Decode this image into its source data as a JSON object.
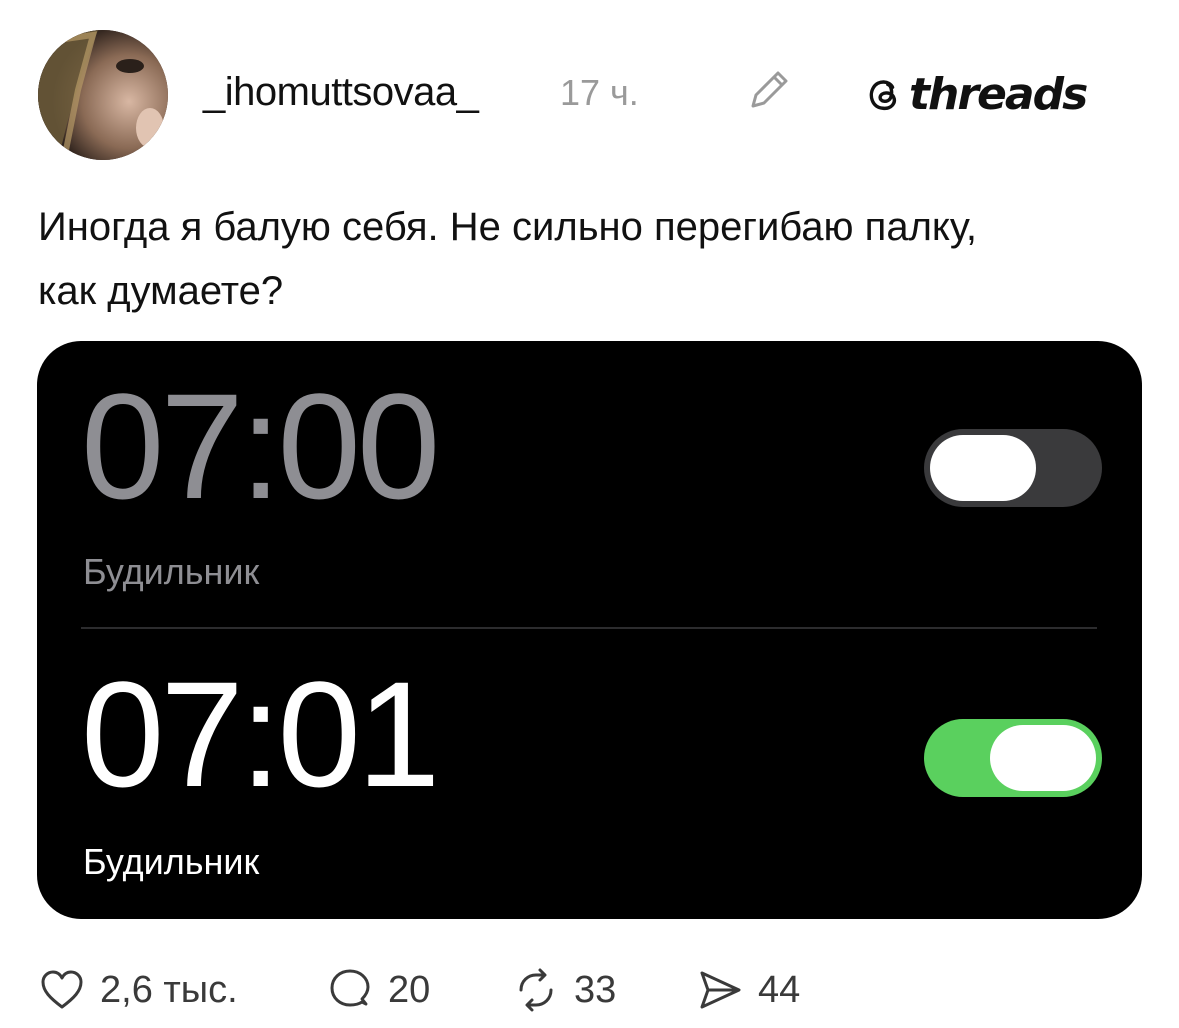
{
  "post": {
    "username": "_ihomuttsovaa_",
    "time": "17 ч.",
    "brand": "threads",
    "text_line1": "Иногда я балую себя. Не сильно перегибаю палку,",
    "text_line2": "как думаете?"
  },
  "alarms": [
    {
      "time": "07:00",
      "label": "Будильник",
      "enabled": false
    },
    {
      "time": "07:01",
      "label": "Будильник",
      "enabled": true
    }
  ],
  "actions": {
    "likes": "2,6 тыс.",
    "replies": "20",
    "reposts": "33",
    "shares": "44"
  },
  "colors": {
    "toggle_on": "#5ad05e",
    "toggle_off": "#3a3a3c",
    "card_bg": "#000000",
    "muted_text": "#8e8e93"
  },
  "icons": {
    "edit": "pencil-icon",
    "like": "heart-icon",
    "reply": "comment-icon",
    "repost": "repost-icon",
    "share": "send-icon",
    "logo": "threads-logo-icon"
  }
}
